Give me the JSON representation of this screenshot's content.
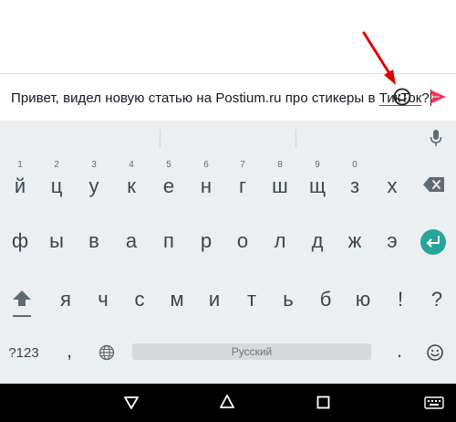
{
  "message": {
    "prefix": "Привет, видел новую статью на Postium.ru про стикеры в ",
    "underlined": "ТикТок",
    "suffix": "?"
  },
  "icons": {
    "emoji": "emoji-smile-icon",
    "send": "send-arrow-icon",
    "mic": "microphone-icon",
    "backspace": "backspace-icon",
    "enter": "enter-icon",
    "shift": "shift-icon",
    "globe": "globe-icon",
    "back": "nav-back-icon",
    "home": "nav-home-icon",
    "recents": "nav-recents-icon",
    "keyboard": "keyboard-icon"
  },
  "colors": {
    "send": "#fe2c55",
    "enter": "#26a69a",
    "arrow": "#e00000",
    "underline": "#e0245e"
  },
  "keyboard": {
    "row1": [
      {
        "label": "й",
        "hint": "1"
      },
      {
        "label": "ц",
        "hint": "2"
      },
      {
        "label": "у",
        "hint": "3"
      },
      {
        "label": "к",
        "hint": "4"
      },
      {
        "label": "е",
        "hint": "5"
      },
      {
        "label": "н",
        "hint": "6"
      },
      {
        "label": "г",
        "hint": "7"
      },
      {
        "label": "ш",
        "hint": "8"
      },
      {
        "label": "щ",
        "hint": "9"
      },
      {
        "label": "з",
        "hint": "0"
      },
      {
        "label": "х",
        "hint": ""
      }
    ],
    "row2": [
      "ф",
      "ы",
      "в",
      "а",
      "п",
      "р",
      "о",
      "л",
      "д",
      "ж",
      "э"
    ],
    "row3": [
      "я",
      "ч",
      "с",
      "м",
      "и",
      "т",
      "ь",
      "б",
      "ю",
      "!",
      "?"
    ],
    "symbols_label": "?123",
    "comma": ",",
    "period": ".",
    "space_label": "Русский"
  }
}
